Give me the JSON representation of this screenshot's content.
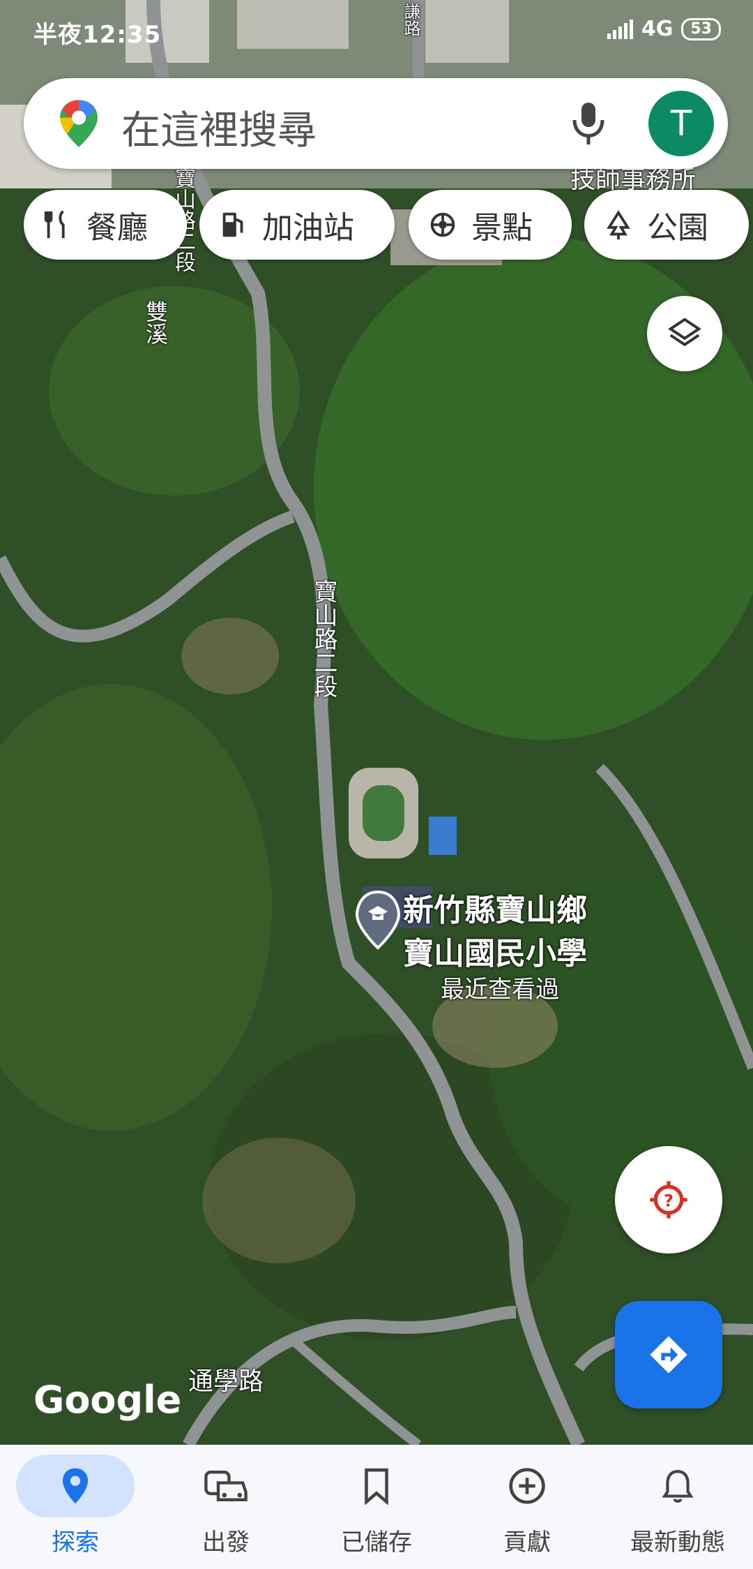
{
  "status_bar": {
    "time": "半夜12:35",
    "network": "4G",
    "battery": "53"
  },
  "search": {
    "placeholder": "在這裡搜尋",
    "avatar_letter": "T"
  },
  "chips": [
    {
      "label": "餐廳",
      "icon": "restaurant-icon"
    },
    {
      "label": "加油站",
      "icon": "gas-station-icon"
    },
    {
      "label": "景點",
      "icon": "attraction-icon"
    },
    {
      "label": "公園",
      "icon": "park-icon"
    }
  ],
  "map": {
    "poi": {
      "name_line1": "新竹縣寶山鄉",
      "name_line2": "寶山國民小學",
      "subtitle": "最近查看過"
    },
    "road_labels": [
      "寶山路二段",
      "寶山路二段",
      "雙溪",
      "通學路",
      "技師事務所",
      "謙路"
    ],
    "attribution": "Google"
  },
  "bottom_nav": [
    {
      "label": "探索",
      "icon": "explore-pin-icon",
      "active": true
    },
    {
      "label": "出發",
      "icon": "commute-car-icon",
      "active": false
    },
    {
      "label": "已儲存",
      "icon": "bookmark-icon",
      "active": false
    },
    {
      "label": "貢獻",
      "icon": "add-circle-icon",
      "active": false
    },
    {
      "label": "最新動態",
      "icon": "bell-icon",
      "active": false
    }
  ],
  "colors": {
    "accent": "#1a73e8",
    "avatar": "#0b8a63",
    "locate_icon": "#d93025"
  }
}
